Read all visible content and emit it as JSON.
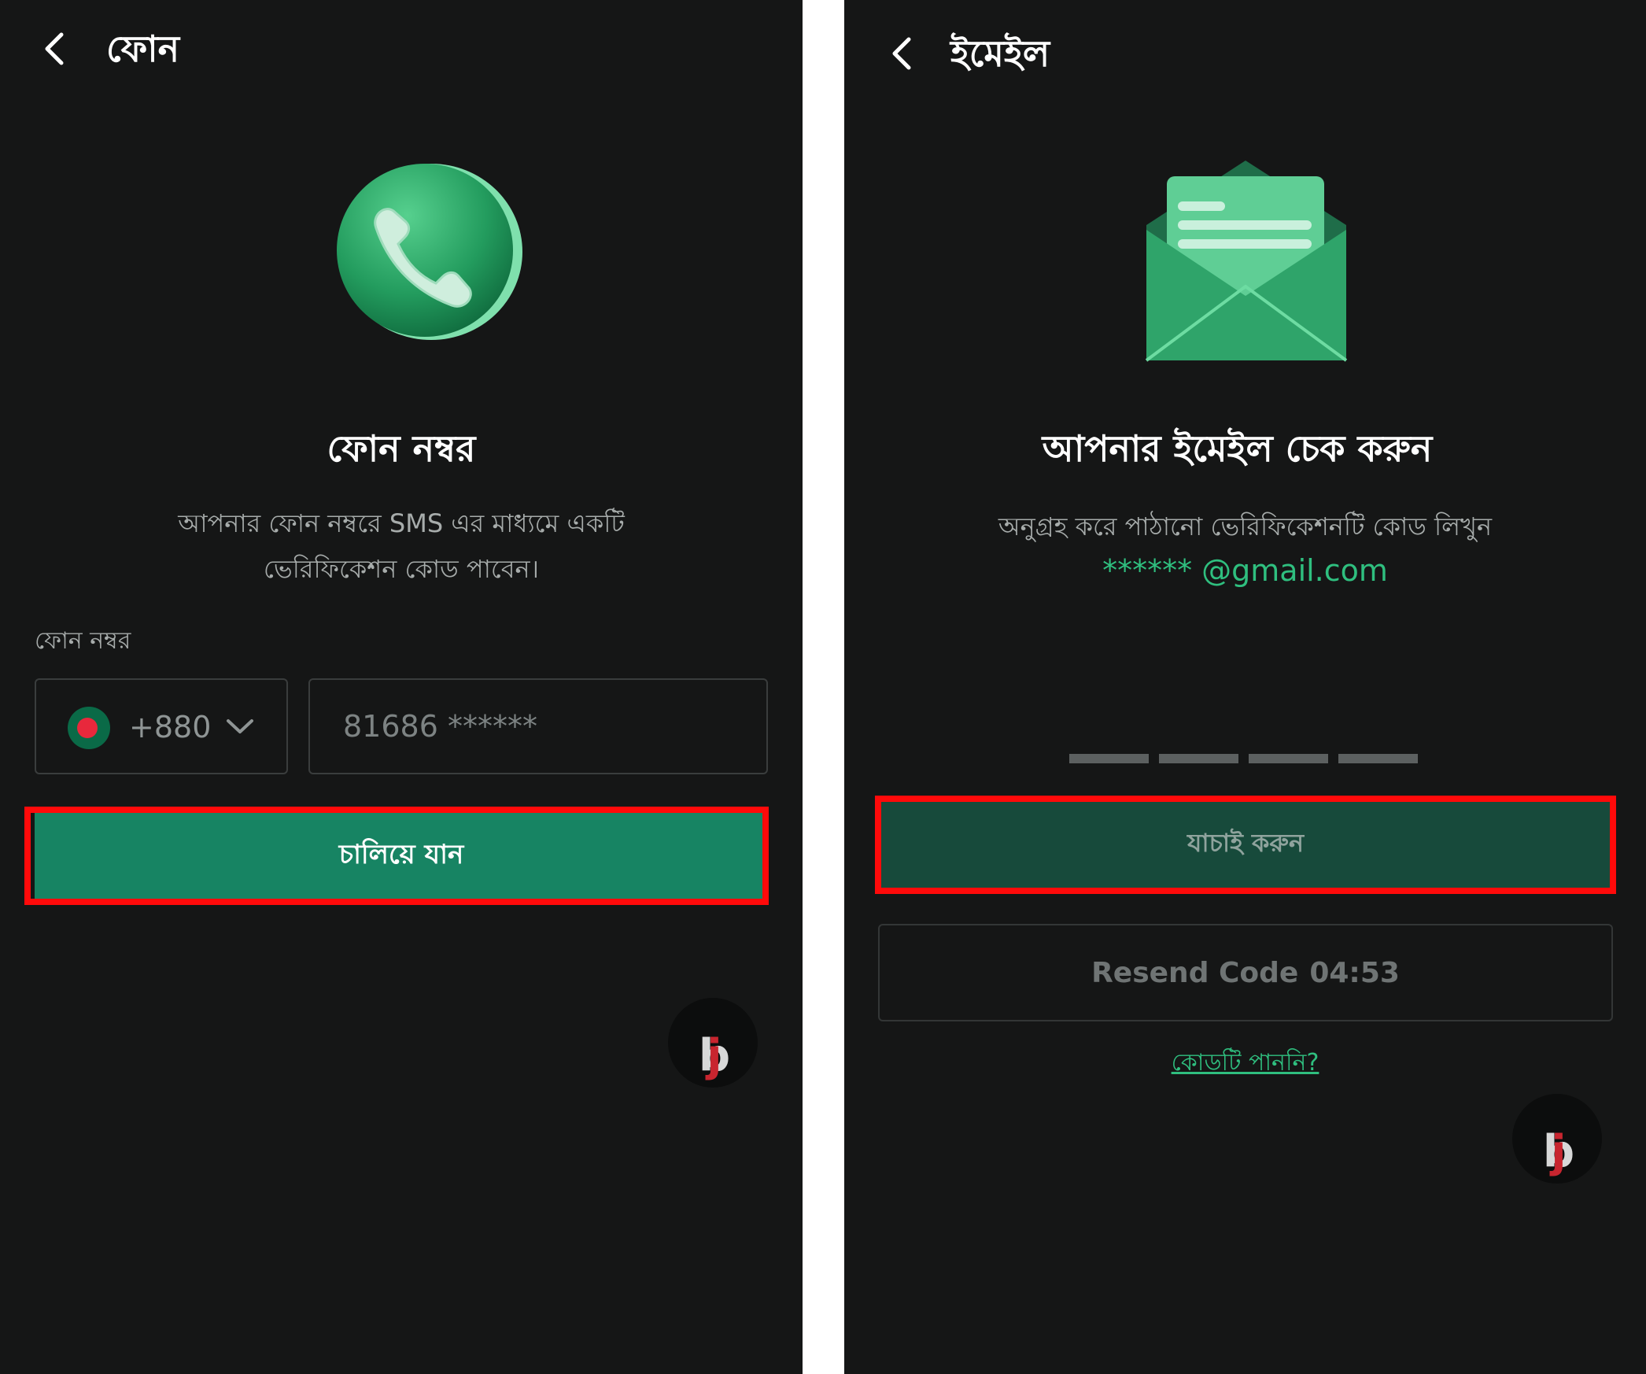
{
  "phone_screen": {
    "title": "ফোন",
    "heading": "ফোন নম্বর",
    "description_line1": "আপনার ফোন নম্বরে SMS এর মাধ্যমে একটি",
    "description_line2": "ভেরিফিকেশন কোড পাবেন।",
    "field_label": "ফোন নম্বর",
    "country_code": "+880",
    "flag_icon": "bangladesh-flag-icon",
    "phone_value": "81686 ******",
    "continue_button": "চালিয়ে যান"
  },
  "email_screen": {
    "title": "ইমেইল",
    "heading": "আপনার ইমেইল চেক করুন",
    "description": "অনুগ্রহ করে পাঠানো ভেরিফিকেশনটি কোড লিখুন",
    "email": "****** @gmail.com",
    "code_slots": 4,
    "verify_button": "যাচাই করুন",
    "resend_label": "Resend Code",
    "resend_timer": "04:53",
    "no_code_link": "কোডটি পাননি?"
  },
  "logo": {
    "b": "b",
    "j": "j"
  },
  "colors": {
    "background": "#151616",
    "primary_green": "#178463",
    "verify_green": "#174a3b",
    "accent_green": "#2fbf7f",
    "highlight_red": "#ff0a0a"
  }
}
